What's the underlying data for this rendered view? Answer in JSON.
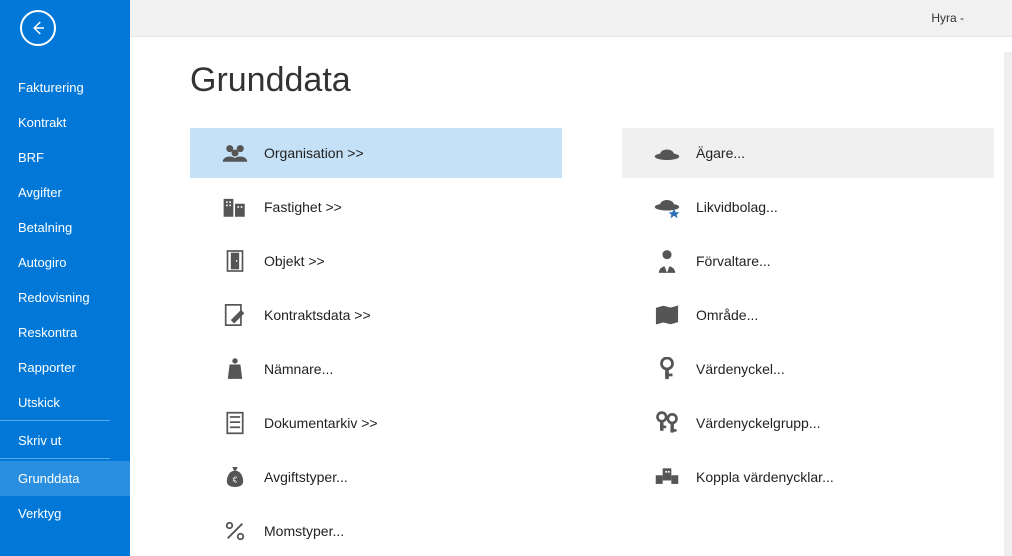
{
  "topbar": {
    "context": "Hyra -"
  },
  "sidebar": {
    "items": [
      {
        "label": "Fakturering"
      },
      {
        "label": "Kontrakt"
      },
      {
        "label": "BRF"
      },
      {
        "label": "Avgifter"
      },
      {
        "label": "Betalning"
      },
      {
        "label": "Autogiro"
      },
      {
        "label": "Redovisning"
      },
      {
        "label": "Reskontra"
      },
      {
        "label": "Rapporter"
      },
      {
        "label": "Utskick"
      },
      {
        "label": "Skriv ut"
      },
      {
        "label": "Grunddata"
      },
      {
        "label": "Verktyg"
      }
    ]
  },
  "page": {
    "title": "Grunddata"
  },
  "tiles_left": [
    {
      "label": "Organisation >>"
    },
    {
      "label": "Fastighet >>"
    },
    {
      "label": "Objekt >>"
    },
    {
      "label": "Kontraktsdata >>"
    },
    {
      "label": "Nämnare..."
    },
    {
      "label": "Dokumentarkiv >>"
    },
    {
      "label": "Avgiftstyper..."
    },
    {
      "label": "Momstyper..."
    }
  ],
  "tiles_right": [
    {
      "label": "Ägare..."
    },
    {
      "label": "Likvidbolag..."
    },
    {
      "label": "Förvaltare..."
    },
    {
      "label": "Område..."
    },
    {
      "label": "Värdenyckel..."
    },
    {
      "label": "Värdenyckelgrupp..."
    },
    {
      "label": "Koppla värdenycklar..."
    }
  ]
}
